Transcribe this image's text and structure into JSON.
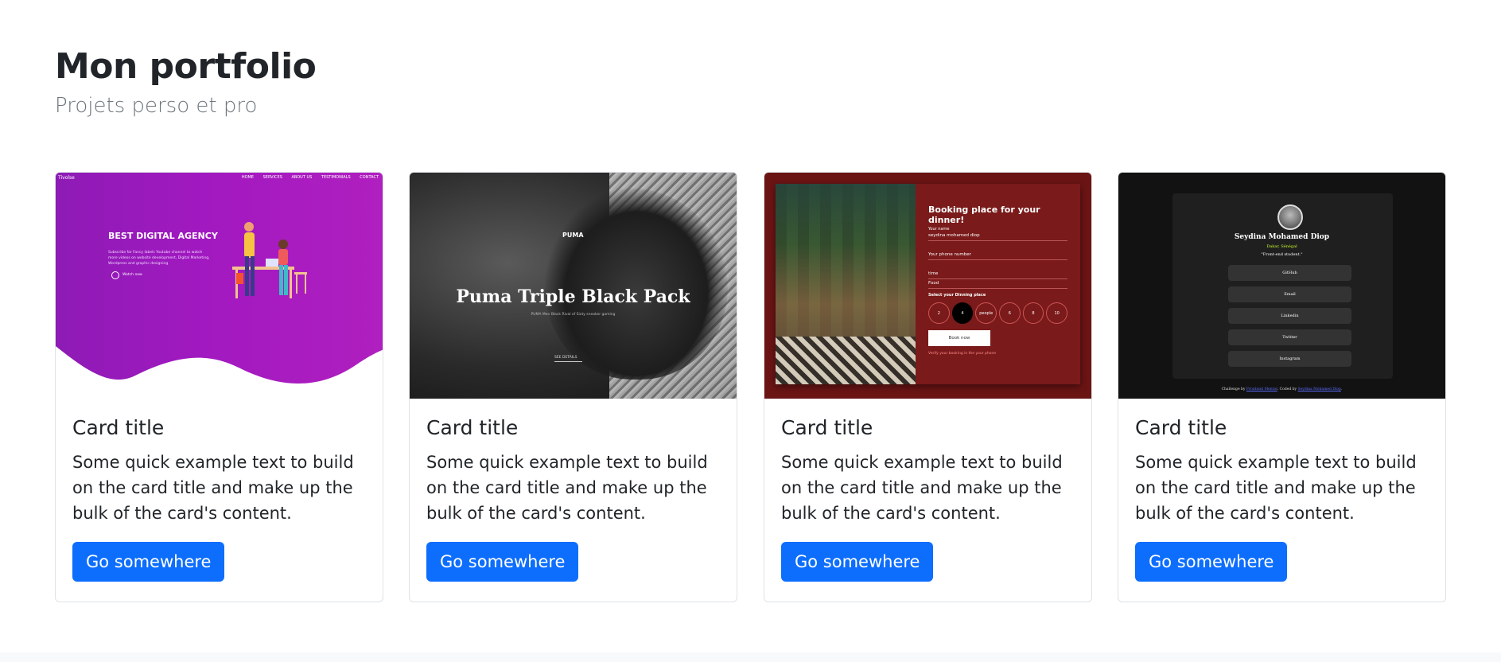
{
  "header": {
    "title": "Mon portfolio",
    "subtitle": "Projets perso et pro"
  },
  "colors": {
    "primary_button": "#0d6efd",
    "card_border": "#dee2e6",
    "subtitle": "#6c757d"
  },
  "cards": [
    {
      "title": "Card title",
      "text": "Some quick example text to build on the card title and make up the bulk of the card's content.",
      "button": "Go somewhere",
      "thumbnail": {
        "brand": "Tivolse",
        "nav": [
          "HOME",
          "SERVICES",
          "ABOUT US",
          "TESTIMONIALS",
          "CONTACT"
        ],
        "headline": "BEST DIGITAL AGENCY",
        "description": "Subscribe for Fancy labels Youtube channel to watch more videos on website development, Digital Marketing, Wordpress and graphic designing",
        "play_label": "Watch now"
      }
    },
    {
      "title": "Card title",
      "text": "Some quick example text to build on the card title and make up the bulk of the card's content.",
      "button": "Go somewhere",
      "thumbnail": {
        "brand": "PUMA",
        "headline": "Puma Triple Black Pack",
        "caption": "PUMA Men Black Rival of Sixty sneaker gaming",
        "cta": "SEE DETAILS"
      }
    },
    {
      "title": "Card title",
      "text": "Some quick example text to build on the card title and make up the bulk of the card's content.",
      "button": "Go somewhere",
      "thumbnail": {
        "headline": "Booking place for your dinner!",
        "name_label": "Your name",
        "name_value": "seydina mohamed diop",
        "phone_label": "Your phone number",
        "time_label": "time",
        "food_label": "Food",
        "dining_label": "Select your Dinning place",
        "seats": [
          "2",
          "4",
          "people",
          "6",
          "8",
          "10"
        ],
        "button": "Book now",
        "note": "Verify your booking in the your phone"
      }
    },
    {
      "title": "Card title",
      "text": "Some quick example text to build on the card title and make up the bulk of the card's content.",
      "button": "Go somewhere",
      "thumbnail": {
        "name": "Seydina Mohamed Diop",
        "location": "Dakar, Sénégal",
        "tagline": "\"Front-end student.\"",
        "links": [
          "GitHub",
          "Email",
          "Linkedin",
          "Twitter",
          "Instagram"
        ],
        "credit_prefix": "Challenge by",
        "credit_author": "Frontend Mentor",
        "credit_mid": ". Coded by",
        "credit_coder": "Seydina Mohamed Diop",
        "credit_suffix": "."
      }
    }
  ]
}
